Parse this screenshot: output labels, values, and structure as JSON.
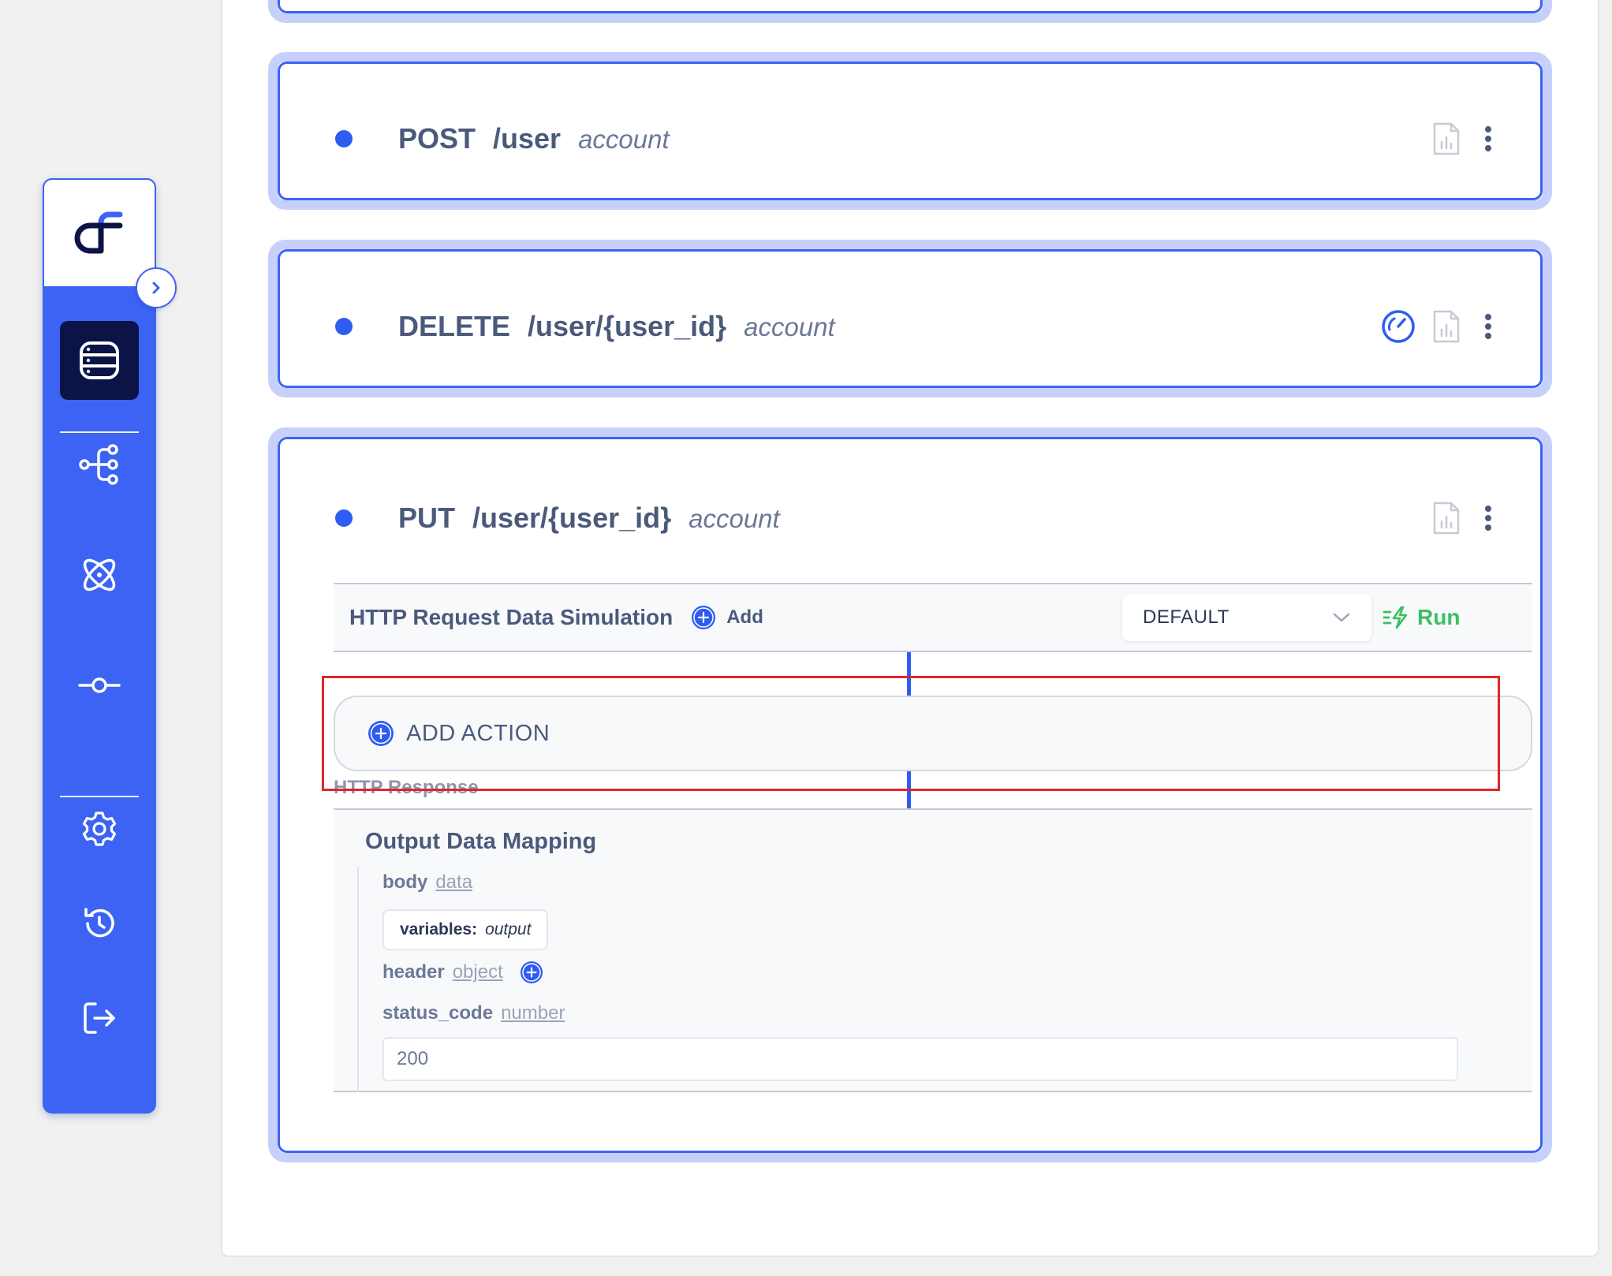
{
  "endpoints": [
    {
      "method": "POST",
      "path": "/user",
      "tag": "account"
    },
    {
      "method": "DELETE",
      "path": "/user/{user_id}",
      "tag": "account"
    },
    {
      "method": "PUT",
      "path": "/user/{user_id}",
      "tag": "account"
    }
  ],
  "simulation": {
    "title": "HTTP Request Data Simulation",
    "add_label": "Add",
    "selected_option": "DEFAULT",
    "run_label": "Run"
  },
  "action": {
    "label": "ADD ACTION"
  },
  "response": {
    "label": "HTTP Response",
    "mapping_title": "Output Data Mapping",
    "body": {
      "name": "body",
      "type": "data"
    },
    "variables": {
      "key": "variables:",
      "value": "output"
    },
    "header": {
      "name": "header",
      "type": "object"
    },
    "status_code": {
      "name": "status_code",
      "type": "number",
      "value": "200"
    }
  },
  "sidebar": {
    "items": [
      {
        "icon": "database-icon",
        "active": true
      },
      {
        "icon": "flow-icon"
      },
      {
        "icon": "atom-icon"
      },
      {
        "icon": "commit-icon"
      },
      {
        "icon": "settings-icon"
      },
      {
        "icon": "history-icon"
      },
      {
        "icon": "logout-icon"
      }
    ]
  },
  "colors": {
    "accent": "#3d63f5",
    "accent_light": "#c6d1fb",
    "sidebar_active": "#0c1447",
    "run": "#3bbf63",
    "highlight": "#e0262b"
  }
}
